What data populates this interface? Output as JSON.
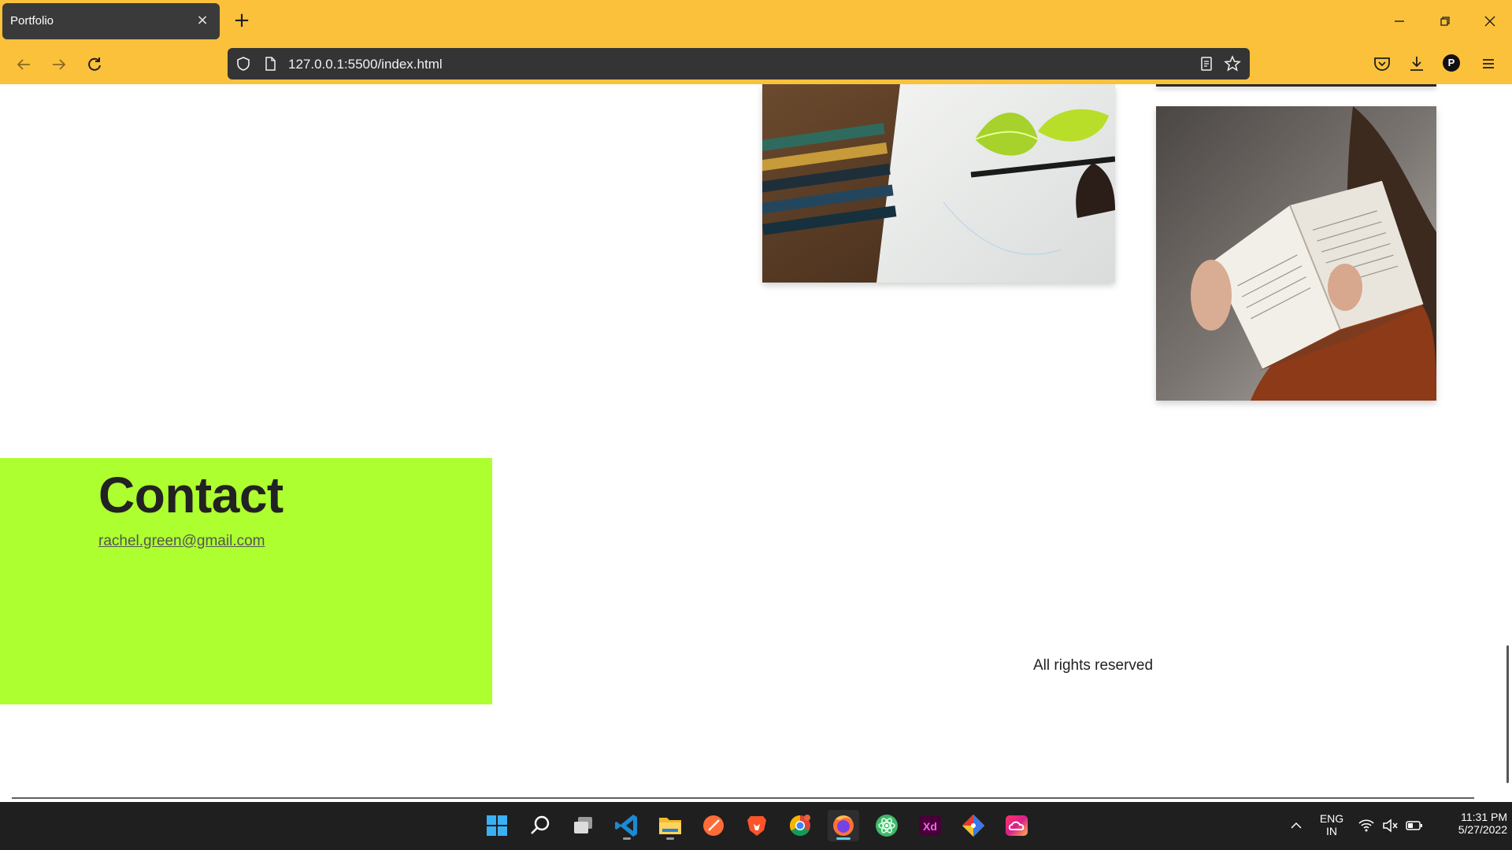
{
  "browser": {
    "tab_title": "Portfolio",
    "tab_close": "×",
    "new_tab": "+",
    "url": "127.0.0.1:5500/index.html",
    "window_controls": {
      "minimize": "–",
      "restore": "❐",
      "close": "✕"
    },
    "profile_initial": "P"
  },
  "page": {
    "contact_title": "Contact",
    "contact_email": "rachel.green@gmail.com",
    "footer": "All rights reserved",
    "colors": {
      "contact_bg": "#adff2f",
      "chrome": "#fbc13b"
    }
  },
  "taskbar": {
    "apps": [
      {
        "name": "start"
      },
      {
        "name": "search"
      },
      {
        "name": "task-view"
      },
      {
        "name": "vscode"
      },
      {
        "name": "file-explorer"
      },
      {
        "name": "postman"
      },
      {
        "name": "brave"
      },
      {
        "name": "chrome"
      },
      {
        "name": "firefox"
      },
      {
        "name": "atom"
      },
      {
        "name": "adobe-xd"
      },
      {
        "name": "git"
      },
      {
        "name": "creative-cloud"
      }
    ],
    "lang_top": "ENG",
    "lang_bottom": "IN",
    "time": "11:31 PM",
    "date": "5/27/2022"
  }
}
